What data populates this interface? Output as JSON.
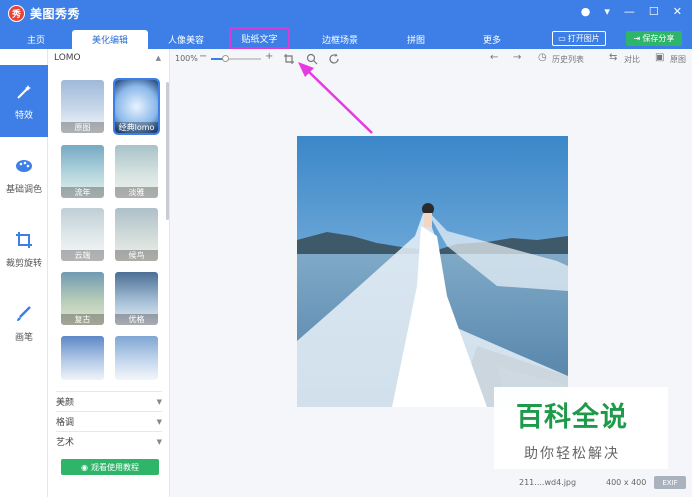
{
  "app": {
    "logo_text": "秀",
    "title": "美图秀秀"
  },
  "nav": {
    "tabs": [
      {
        "label": "主页"
      },
      {
        "label": "美化编辑"
      },
      {
        "label": "人像美容"
      },
      {
        "label": "贴纸文字"
      },
      {
        "label": "边框场景"
      },
      {
        "label": "拼图"
      },
      {
        "label": "更多"
      }
    ],
    "open_label": "打开图片",
    "save_label": "保存分享"
  },
  "rail": {
    "items": [
      {
        "label": "特效",
        "icon": "magic-wand-icon"
      },
      {
        "label": "基础调色",
        "icon": "palette-icon"
      },
      {
        "label": "裁剪旋转",
        "icon": "crop-icon"
      },
      {
        "label": "画笔",
        "icon": "brush-icon"
      }
    ]
  },
  "panel": {
    "category": "LOMO",
    "filters": [
      {
        "label": "原图"
      },
      {
        "label": "经典lomo"
      },
      {
        "label": "流年"
      },
      {
        "label": "淡雅"
      },
      {
        "label": "云端"
      },
      {
        "label": "候鸟"
      },
      {
        "label": "复古"
      },
      {
        "label": "优格"
      },
      {
        "label": ""
      },
      {
        "label": ""
      }
    ],
    "sections": [
      "美颜",
      "格调",
      "艺术"
    ],
    "tutorial_label": "观看使用教程"
  },
  "toolbar": {
    "zoom": "100%",
    "history": "历史列表",
    "compare": "对比",
    "original": "原图"
  },
  "canvas": {
    "filename": "211....wd4.jpg",
    "dimensions": "400 x 400",
    "exif": "EXIF"
  },
  "watermark": {
    "title": "百科全说",
    "subtitle": "助你轻松解决"
  },
  "colors": {
    "accent": "#3d7fe6",
    "save": "#2fb56a",
    "highlight": "#d63bd6"
  }
}
